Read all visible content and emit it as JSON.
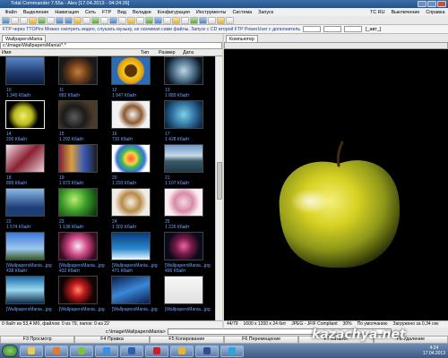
{
  "window": {
    "title": "Total Commander 7.55a - Alex [17.04.2013 - 04:24:26]"
  },
  "menubar": {
    "items": [
      "Файл",
      "Выделение",
      "Навигация",
      "Сеть",
      "FTP",
      "Вид",
      "Вкладки",
      "Конфигурация",
      "Инструменты",
      "Система",
      "Запуск"
    ],
    "right_items": [
      "TC RU",
      "Выключение",
      "Справка"
    ]
  },
  "ticker": {
    "message": "FTP через TTOPirs  Можно смотреть видео, слушать музыку, не скачивая сами файлы. Запуск с CD второй FTP PowerUser с дополнительными программами",
    "tag": "[_авт_]"
  },
  "left_panel": {
    "tab": "WallpapersMania",
    "path": "c:\\Image\\WallpapersMania\\*.*",
    "columns": {
      "name": "Имя",
      "type": "Тип",
      "size": "Размер",
      "date": "Дата"
    },
    "thumbs": [
      {
        "c1": "10",
        "c2": "1 345 Кбайт",
        "art": "sea"
      },
      {
        "c1": "11",
        "c2": "882 Кбайт",
        "art": "dog"
      },
      {
        "c1": "12",
        "c2": "1 947 Кбайт",
        "art": "sunflower"
      },
      {
        "c1": "13",
        "c2": "1 889 Кбайт",
        "art": "xray"
      },
      {
        "c1": "14",
        "c2": "200 Кбайт",
        "art": "apple",
        "selected": true
      },
      {
        "c1": "15",
        "c2": "1 292 Кбайт",
        "art": "balls"
      },
      {
        "c1": "16",
        "c2": "710 Кбайт",
        "art": "coconut"
      },
      {
        "c1": "17",
        "c2": "1 428 Кбайт",
        "art": "figure"
      },
      {
        "c1": "18",
        "c2": "899 Кбайт",
        "art": "glass"
      },
      {
        "c1": "19",
        "c2": "1 872 Кбайт",
        "art": "collage"
      },
      {
        "c1": "20",
        "c2": "1 293 Кбайт",
        "art": "stripeball"
      },
      {
        "c1": "21",
        "c2": "1 107 Кбайт",
        "art": "lake"
      },
      {
        "c1": "22",
        "c2": "1 574 Кбайт",
        "art": "hands"
      },
      {
        "c1": "23",
        "c2": "1 138 Кбайт",
        "art": "green"
      },
      {
        "c1": "24",
        "c2": "1 302 Кбайт",
        "art": "leaves"
      },
      {
        "c1": "25",
        "c2": "1 226 Кбайт",
        "art": "flowers"
      },
      {
        "c1": "[WallpapersMania...jpg",
        "c2": "438 Кбайт",
        "art": "bluesky"
      },
      {
        "c1": "[WallpapersMania...jpg",
        "c2": "432 Кбайт",
        "art": "pinkflower"
      },
      {
        "c1": "[WallpapersMania...jpg",
        "c2": "471 Кбайт",
        "art": "underwater"
      },
      {
        "c1": "[WallpapersMania...jpg",
        "c2": "496 Кбайт",
        "art": "darkflower"
      },
      {
        "c1": "[WallpapersMania...jpg",
        "c2": "",
        "art": "ice"
      },
      {
        "c1": "[WallpapersMania...jpg",
        "c2": "",
        "art": "redlight"
      },
      {
        "c1": "[WallpapersMania...jpg",
        "c2": "",
        "art": "bluewave"
      },
      {
        "c1": "[WallpapersMania...jpg",
        "c2": "",
        "art": "oilpump"
      }
    ],
    "status": "0 байт из 53,4 Мб, файлов: 0 из 79, папок: 0 из 22"
  },
  "right_panel": {
    "tab": "Компьютер",
    "info": [
      "44/79",
      "1600 x 1200 x 24 бит",
      "JPEG - JFIF Compliant",
      "30%",
      "По умолчанию",
      "Загружено за 0,34 сек"
    ]
  },
  "cmdline": {
    "prompt": "c:\\Image\\WallpapersMania>"
  },
  "fkeys": [
    "F3 Просмотр",
    "F4 Правка",
    "F5 Копирование",
    "F6 Перемещение",
    "F7 Каталог",
    "F8 Удаление"
  ],
  "taskbar": {
    "time": "4:24",
    "date": "17.04.2013"
  },
  "watermark": "kazachya.net"
}
